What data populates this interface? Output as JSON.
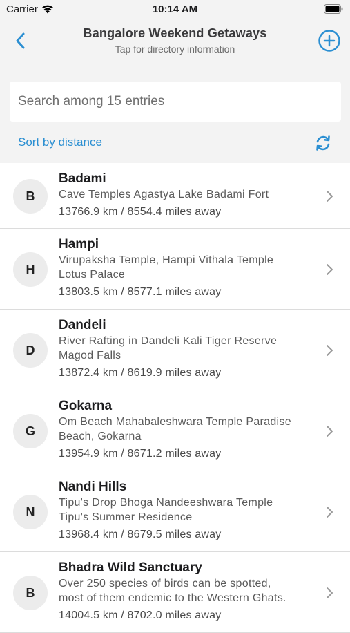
{
  "status_bar": {
    "carrier": "Carrier",
    "time": "10:14 AM"
  },
  "nav": {
    "title": "Bangalore Weekend Getaways",
    "subtitle": "Tap for directory information"
  },
  "search": {
    "placeholder": "Search among 15 entries"
  },
  "sort": {
    "label": "Sort by distance"
  },
  "colors": {
    "accent": "#2b8fd2",
    "background": "#f3f3f3"
  },
  "icons": {
    "back": "chevron-left-icon",
    "add": "plus-circle-icon",
    "refresh": "refresh-icon",
    "row": "chevron-right-icon"
  },
  "entries": [
    {
      "initial": "B",
      "title": "Badami",
      "desc": [
        "Cave Temples Agastya Lake Badami Fort"
      ],
      "distance": "13766.9 km / 8554.4 miles away"
    },
    {
      "initial": "H",
      "title": "Hampi",
      "desc": [
        "Virupaksha Temple, Hampi Vithala Temple",
        "Lotus Palace"
      ],
      "distance": "13803.5 km / 8577.1 miles away"
    },
    {
      "initial": "D",
      "title": "Dandeli",
      "desc": [
        "River Rafting in Dandeli Kali Tiger Reserve",
        "Magod Falls"
      ],
      "distance": "13872.4 km / 8619.9 miles away"
    },
    {
      "initial": "G",
      "title": "Gokarna",
      "desc": [
        "Om Beach Mahabaleshwara Temple Paradise",
        "Beach, Gokarna"
      ],
      "distance": "13954.9 km / 8671.2 miles away"
    },
    {
      "initial": "N",
      "title": "Nandi Hills",
      "desc": [
        "Tipu's Drop Bhoga Nandeeshwara Temple",
        "Tipu's Summer Residence"
      ],
      "distance": "13968.4 km / 8679.5 miles away"
    },
    {
      "initial": "B",
      "title": "Bhadra Wild Sanctuary",
      "desc": [
        "Over 250 species of birds can be spotted,",
        "most of them endemic to the Western Ghats."
      ],
      "distance": "14004.5 km / 8702.0 miles away"
    }
  ]
}
